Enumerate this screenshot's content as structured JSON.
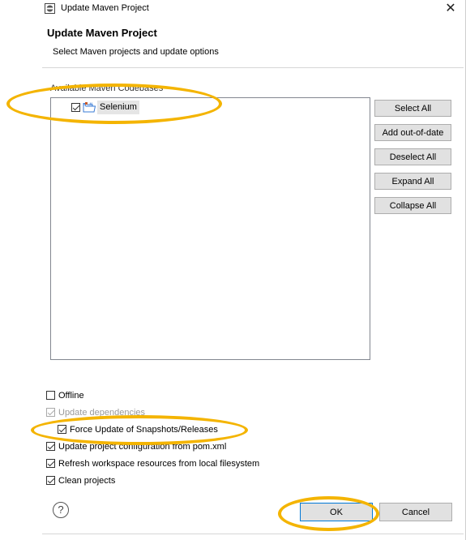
{
  "window": {
    "title": "Update Maven Project",
    "close_glyph": "✕"
  },
  "header": {
    "title": "Update Maven Project",
    "description": "Select Maven projects and update options"
  },
  "codebases": {
    "label": "Available Maven Codebases",
    "items": [
      {
        "label": "Selenium",
        "checked": true,
        "icon": "project-folder-icon"
      }
    ]
  },
  "side_buttons": {
    "select_all": "Select All",
    "add_out_of_date": "Add out-of-date",
    "deselect_all": "Deselect All",
    "expand_all": "Expand All",
    "collapse_all": "Collapse All"
  },
  "options": {
    "offline": {
      "label": "Offline",
      "checked": false,
      "enabled": true
    },
    "update_dependencies": {
      "label": "Update dependencies",
      "checked": true,
      "enabled": false
    },
    "force_update": {
      "label": "Force Update of Snapshots/Releases",
      "checked": true,
      "enabled": true
    },
    "update_config": {
      "label": "Update project configuration from pom.xml",
      "checked": true,
      "enabled": true
    },
    "refresh_workspace": {
      "label": "Refresh workspace resources from local filesystem",
      "checked": true,
      "enabled": true
    },
    "clean_projects": {
      "label": "Clean projects",
      "checked": true,
      "enabled": true
    }
  },
  "footer": {
    "help_glyph": "?",
    "ok": "OK",
    "cancel": "Cancel"
  },
  "annotations": {
    "highlight_color": "#f4b400"
  }
}
